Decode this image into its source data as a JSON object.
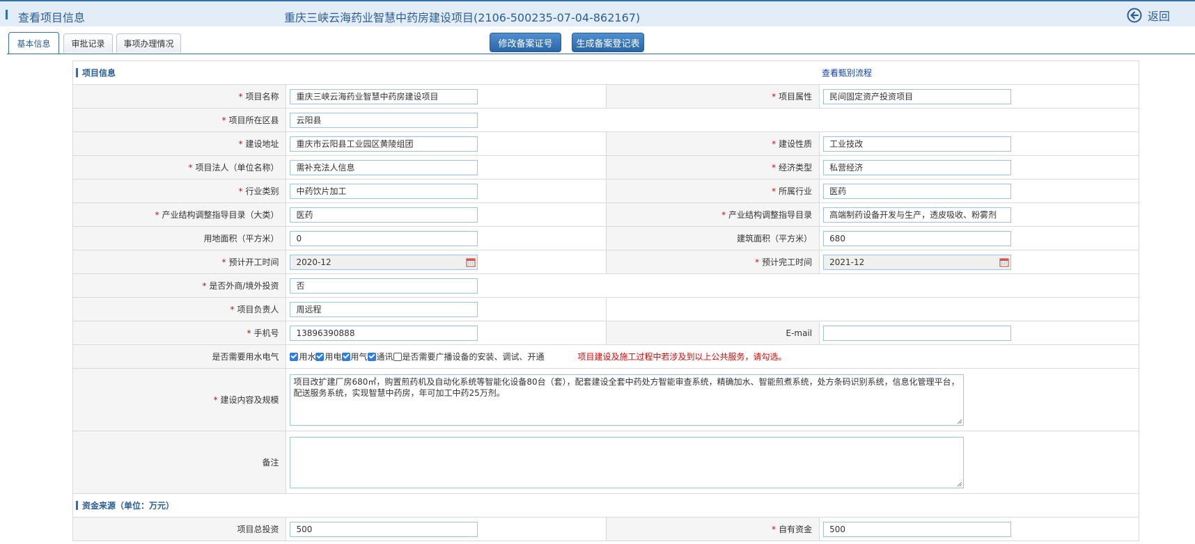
{
  "header": {
    "title": "查看项目信息",
    "project": "重庆三峡云海药业智慧中药房建设项目(2106-500235-07-04-862167)",
    "back_label": "返回"
  },
  "tabs": [
    "基本信息",
    "审批记录",
    "事项办理情况"
  ],
  "actions": {
    "modify": "修改备案证号",
    "generate": "生成备案登记表"
  },
  "sections": {
    "project_info": "项目信息",
    "view_flow": "查看甄别流程",
    "funding": "资金来源（单位：万元）"
  },
  "form": {
    "project_name": {
      "label": "项目名称",
      "value": "重庆三峡云海药业智慧中药房建设项目"
    },
    "project_attr": {
      "label": "项目属性",
      "value": "民间固定资产投资项目"
    },
    "district": {
      "label": "项目所在区县",
      "value": "云阳县"
    },
    "address": {
      "label": "建设地址",
      "value": "重庆市云阳县工业园区黄陵组团"
    },
    "nature": {
      "label": "建设性质",
      "value": "工业技改"
    },
    "legal_person": {
      "label": "项目法人（单位名称）",
      "value": "需补充法人信息"
    },
    "economy_type": {
      "label": "经济类型",
      "value": "私营经济"
    },
    "industry_cat": {
      "label": "行业类别",
      "value": "中药饮片加工"
    },
    "industry": {
      "label": "所属行业",
      "value": "医药"
    },
    "guide_major": {
      "label": "产业结构调整指导目录（大类）",
      "value": "医药"
    },
    "guide": {
      "label": "产业结构调整指导目录",
      "value": "高端制药设备开发与生产，透皮吸收、粉雾剂"
    },
    "land_area": {
      "label": "用地面积（平方米）",
      "value": "0"
    },
    "building_area": {
      "label": "建筑面积（平方米）",
      "value": "680"
    },
    "start_date": {
      "label": "预计开工时间",
      "value": "2020-12"
    },
    "end_date": {
      "label": "预计完工时间",
      "value": "2021-12"
    },
    "foreign": {
      "label": "是否外商/境外投资",
      "value": "否"
    },
    "manager": {
      "label": "项目负责人",
      "value": "周远程"
    },
    "phone": {
      "label": "手机号",
      "value": "13896390888"
    },
    "email": {
      "label": "E-mail",
      "value": ""
    },
    "utilities": {
      "label": "是否需要用水电气",
      "options": [
        {
          "label": "用水",
          "checked": true
        },
        {
          "label": "用电",
          "checked": true
        },
        {
          "label": "用气",
          "checked": true
        },
        {
          "label": "通讯",
          "checked": true
        },
        {
          "label": "是否需要广播设备的安装、调试、开通",
          "checked": false
        }
      ],
      "note": "项目建设及施工过程中若涉及到以上公共服务，请勾选。"
    },
    "content": {
      "label": "建设内容及规模",
      "value": "项目改扩建厂房680㎡，购置煎药机及自动化系统等智能化设备80台（套），配套建设全套中药处方智能审查系统，精确加水、智能煎煮系统，处方条码识别系统，信息化管理平台，配送服务系统，实现智慧中药房，年可加工中药25万剂。"
    },
    "remark": {
      "label": "备注",
      "value": ""
    },
    "total_invest": {
      "label": "项目总投资",
      "value": "500"
    },
    "own_funds": {
      "label": "自有资金",
      "value": "500"
    }
  }
}
